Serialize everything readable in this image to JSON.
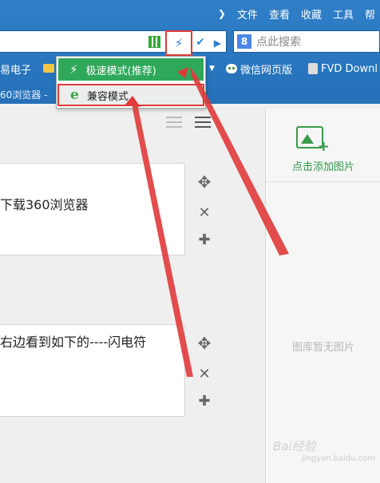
{
  "menubar": {
    "items": [
      "文件",
      "查看",
      "收藏",
      "工具",
      "帮"
    ]
  },
  "search": {
    "engine_badge": "8",
    "placeholder": "点此搜索"
  },
  "favorites": {
    "left_label": "易电子",
    "wechat_label": "微信网页版",
    "fvd_label": "FVD Downl"
  },
  "tabbar": {
    "label": "60浏览器 -"
  },
  "dropdown": {
    "fast_mode": "极速模式(推荐)",
    "compat_mode": "兼容模式"
  },
  "steps": [
    {
      "text": "下载360浏览器"
    },
    {
      "text": "右边看到如下的----闪电符"
    }
  ],
  "panel": {
    "add_label": "点击添加图片",
    "empty_label": "图库暂无图片"
  },
  "watermark": {
    "brand": "Bai经验",
    "sub": "jingyan.baidu.com"
  },
  "colors": {
    "chrome": "#2f7fc8",
    "accent_green": "#2fa85a",
    "annotation_red": "#e03a3a"
  }
}
